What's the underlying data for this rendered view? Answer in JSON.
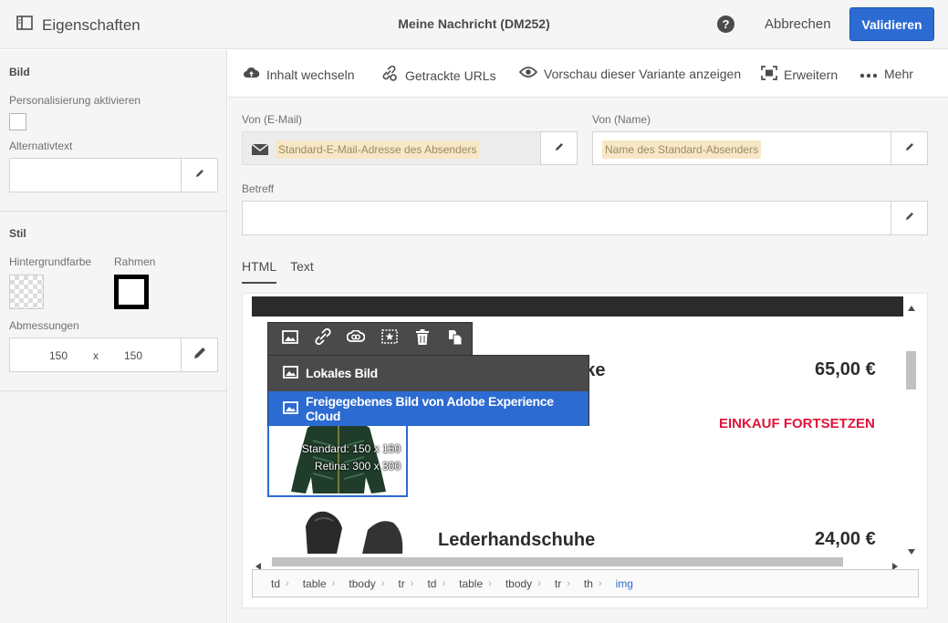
{
  "topbar": {
    "properties_label": "Eigenschaften",
    "title": "Meine Nachricht (DM252)",
    "help": "?",
    "cancel": "Abbrechen",
    "validate": "Validieren"
  },
  "sidebar": {
    "image_section": "Bild",
    "personalization_label": "Personalisierung aktivieren",
    "alttext_label": "Alternativtext",
    "style_section": "Stil",
    "bgcolor_label": "Hintergrundfarbe",
    "border_label": "Rahmen",
    "dimensions_label": "Abmessungen",
    "width": "150",
    "x": "x",
    "height": "150"
  },
  "toolbar": {
    "change_content": "Inhalt wechseln",
    "tracked_urls": "Getrackte URLs",
    "preview": "Vorschau dieser Variante anzeigen",
    "expand": "Erweitern",
    "more": "Mehr"
  },
  "form": {
    "from_email_label": "Von (E-Mail)",
    "from_email_placeholder": "Standard-E-Mail-Adresse des Absenders",
    "from_name_label": "Von (Name)",
    "from_name_placeholder": "Name des Standard-Absenders",
    "subject_label": "Betreff"
  },
  "tabs": [
    "HTML",
    "Text"
  ],
  "content": {
    "product1_name_partial": "acke",
    "product1_price": "65,00 €",
    "cta": "EINKAUF FORTSETZEN",
    "image_standard": "Standard: 150 x 150",
    "image_retina": "Retina: 300 x 300",
    "product2_name": "Lederhandschuhe",
    "product2_price": "24,00 €"
  },
  "image_menu": {
    "local_image": "Lokales Bild",
    "shared_image": "Freigegebenes Bild von Adobe Experience Cloud"
  },
  "breadcrumb": [
    "td",
    "table",
    "tbody",
    "tr",
    "td",
    "table",
    "tbody",
    "tr",
    "th",
    "img"
  ],
  "colors": {
    "accent": "#2c6bd1",
    "cta": "#e0133a",
    "placeholder_highlight": "#f7e7c5"
  }
}
